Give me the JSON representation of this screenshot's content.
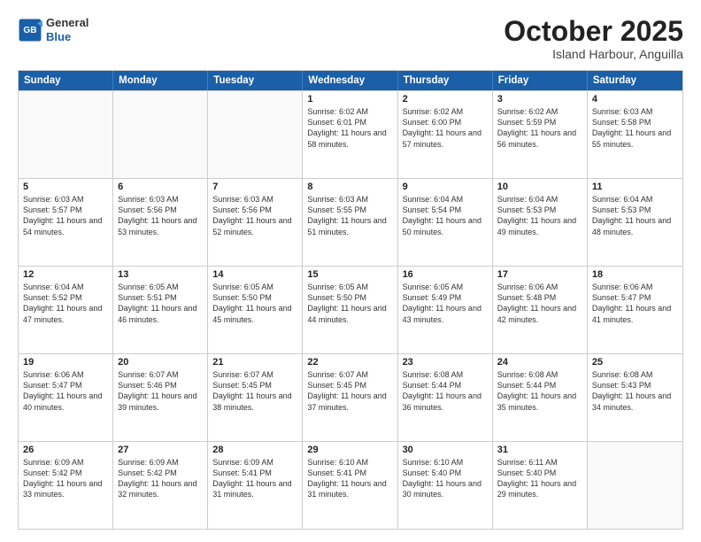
{
  "header": {
    "logo_line1": "General",
    "logo_line2": "Blue",
    "month": "October 2025",
    "location": "Island Harbour, Anguilla"
  },
  "days_of_week": [
    "Sunday",
    "Monday",
    "Tuesday",
    "Wednesday",
    "Thursday",
    "Friday",
    "Saturday"
  ],
  "weeks": [
    [
      {
        "day": "",
        "empty": true
      },
      {
        "day": "",
        "empty": true
      },
      {
        "day": "",
        "empty": true
      },
      {
        "day": "1",
        "sunrise": "6:02 AM",
        "sunset": "6:01 PM",
        "daylight": "11 hours and 58 minutes."
      },
      {
        "day": "2",
        "sunrise": "6:02 AM",
        "sunset": "6:00 PM",
        "daylight": "11 hours and 57 minutes."
      },
      {
        "day": "3",
        "sunrise": "6:02 AM",
        "sunset": "5:59 PM",
        "daylight": "11 hours and 56 minutes."
      },
      {
        "day": "4",
        "sunrise": "6:03 AM",
        "sunset": "5:58 PM",
        "daylight": "11 hours and 55 minutes."
      }
    ],
    [
      {
        "day": "5",
        "sunrise": "6:03 AM",
        "sunset": "5:57 PM",
        "daylight": "11 hours and 54 minutes."
      },
      {
        "day": "6",
        "sunrise": "6:03 AM",
        "sunset": "5:56 PM",
        "daylight": "11 hours and 53 minutes."
      },
      {
        "day": "7",
        "sunrise": "6:03 AM",
        "sunset": "5:56 PM",
        "daylight": "11 hours and 52 minutes."
      },
      {
        "day": "8",
        "sunrise": "6:03 AM",
        "sunset": "5:55 PM",
        "daylight": "11 hours and 51 minutes."
      },
      {
        "day": "9",
        "sunrise": "6:04 AM",
        "sunset": "5:54 PM",
        "daylight": "11 hours and 50 minutes."
      },
      {
        "day": "10",
        "sunrise": "6:04 AM",
        "sunset": "5:53 PM",
        "daylight": "11 hours and 49 minutes."
      },
      {
        "day": "11",
        "sunrise": "6:04 AM",
        "sunset": "5:53 PM",
        "daylight": "11 hours and 48 minutes."
      }
    ],
    [
      {
        "day": "12",
        "sunrise": "6:04 AM",
        "sunset": "5:52 PM",
        "daylight": "11 hours and 47 minutes."
      },
      {
        "day": "13",
        "sunrise": "6:05 AM",
        "sunset": "5:51 PM",
        "daylight": "11 hours and 46 minutes."
      },
      {
        "day": "14",
        "sunrise": "6:05 AM",
        "sunset": "5:50 PM",
        "daylight": "11 hours and 45 minutes."
      },
      {
        "day": "15",
        "sunrise": "6:05 AM",
        "sunset": "5:50 PM",
        "daylight": "11 hours and 44 minutes."
      },
      {
        "day": "16",
        "sunrise": "6:05 AM",
        "sunset": "5:49 PM",
        "daylight": "11 hours and 43 minutes."
      },
      {
        "day": "17",
        "sunrise": "6:06 AM",
        "sunset": "5:48 PM",
        "daylight": "11 hours and 42 minutes."
      },
      {
        "day": "18",
        "sunrise": "6:06 AM",
        "sunset": "5:47 PM",
        "daylight": "11 hours and 41 minutes."
      }
    ],
    [
      {
        "day": "19",
        "sunrise": "6:06 AM",
        "sunset": "5:47 PM",
        "daylight": "11 hours and 40 minutes."
      },
      {
        "day": "20",
        "sunrise": "6:07 AM",
        "sunset": "5:46 PM",
        "daylight": "11 hours and 39 minutes."
      },
      {
        "day": "21",
        "sunrise": "6:07 AM",
        "sunset": "5:45 PM",
        "daylight": "11 hours and 38 minutes."
      },
      {
        "day": "22",
        "sunrise": "6:07 AM",
        "sunset": "5:45 PM",
        "daylight": "11 hours and 37 minutes."
      },
      {
        "day": "23",
        "sunrise": "6:08 AM",
        "sunset": "5:44 PM",
        "daylight": "11 hours and 36 minutes."
      },
      {
        "day": "24",
        "sunrise": "6:08 AM",
        "sunset": "5:44 PM",
        "daylight": "11 hours and 35 minutes."
      },
      {
        "day": "25",
        "sunrise": "6:08 AM",
        "sunset": "5:43 PM",
        "daylight": "11 hours and 34 minutes."
      }
    ],
    [
      {
        "day": "26",
        "sunrise": "6:09 AM",
        "sunset": "5:42 PM",
        "daylight": "11 hours and 33 minutes."
      },
      {
        "day": "27",
        "sunrise": "6:09 AM",
        "sunset": "5:42 PM",
        "daylight": "11 hours and 32 minutes."
      },
      {
        "day": "28",
        "sunrise": "6:09 AM",
        "sunset": "5:41 PM",
        "daylight": "11 hours and 31 minutes."
      },
      {
        "day": "29",
        "sunrise": "6:10 AM",
        "sunset": "5:41 PM",
        "daylight": "11 hours and 31 minutes."
      },
      {
        "day": "30",
        "sunrise": "6:10 AM",
        "sunset": "5:40 PM",
        "daylight": "11 hours and 30 minutes."
      },
      {
        "day": "31",
        "sunrise": "6:11 AM",
        "sunset": "5:40 PM",
        "daylight": "11 hours and 29 minutes."
      },
      {
        "day": "",
        "empty": true
      }
    ]
  ]
}
